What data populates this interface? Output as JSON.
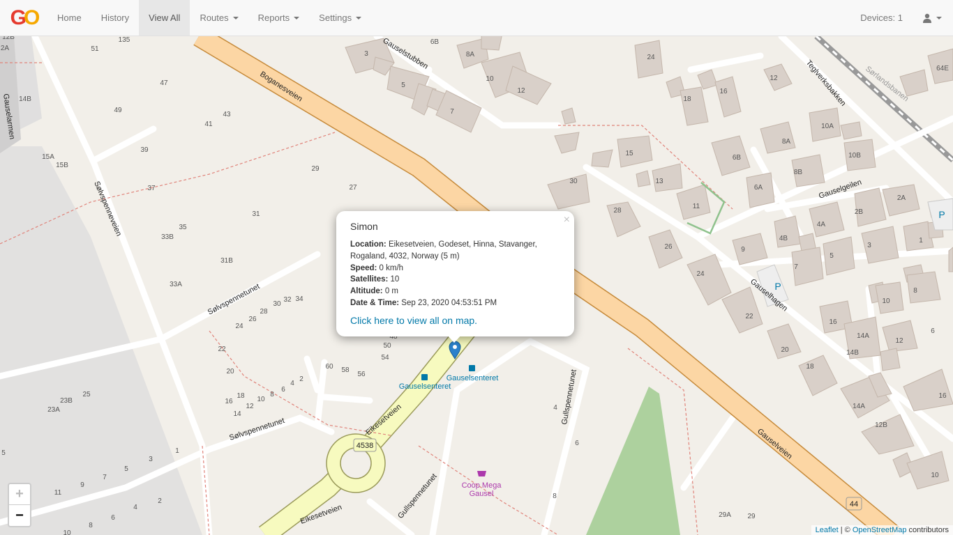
{
  "navbar": {
    "brand": {
      "g": "G",
      "o": "O"
    },
    "items": [
      {
        "label": "Home"
      },
      {
        "label": "History"
      },
      {
        "label": "View All"
      },
      {
        "label": "Routes"
      },
      {
        "label": "Reports"
      },
      {
        "label": "Settings"
      }
    ],
    "devices": "Devices: 1"
  },
  "map": {
    "streets": [
      "Boganesveien",
      "Gauselstubben",
      "Teglverksbakken",
      "Sørlandsbanen",
      "Gauselgeilen",
      "Gauselhagen",
      "Sølvspenneveien",
      "Sølvspennetunet",
      "Eikesetveien",
      "Gullspennetunet",
      "Gauselveien",
      "Gauselarmen"
    ],
    "road_numbers": [
      "4538",
      "44"
    ],
    "pois": [
      "Gauselsenteret",
      "Coop Mega Gausel"
    ],
    "house_numbers": [
      "135",
      "51",
      "47",
      "49",
      "43",
      "41",
      "39",
      "37",
      "29",
      "27",
      "31",
      "35",
      "33B",
      "31B",
      "33A",
      "32",
      "34",
      "30",
      "28",
      "26",
      "24",
      "22",
      "20",
      "18",
      "16",
      "14",
      "12",
      "10",
      "8",
      "6",
      "4",
      "2",
      "60",
      "58",
      "56",
      "54",
      "50",
      "48",
      "25",
      "23B",
      "23A",
      "1",
      "3",
      "5",
      "7",
      "9",
      "11",
      "15A",
      "15B",
      "14B",
      "12B",
      "2A",
      "3",
      "8A",
      "10",
      "12",
      "6B",
      "7",
      "24",
      "16",
      "18",
      "12",
      "64E",
      "15",
      "13",
      "11",
      "28",
      "26",
      "30",
      "24",
      "22",
      "9",
      "10A",
      "8A",
      "6B",
      "8B",
      "6A",
      "10B",
      "2A",
      "2B",
      "4A",
      "4B",
      "1",
      "3",
      "5",
      "7",
      "8",
      "10",
      "16",
      "20",
      "18",
      "12",
      "14A",
      "14B",
      "12B",
      "16",
      "6",
      "29A",
      "29"
    ],
    "parking": "P",
    "zoom_in": "+",
    "zoom_out": "−"
  },
  "popup": {
    "close": "×",
    "title": "Simon",
    "location_label": "Location:",
    "location": "Eikesetveien, Godeset, Hinna, Stavanger, Rogaland, 4032, Norway (5 m)",
    "speed_label": "Speed:",
    "speed": "0 km/h",
    "satellites_label": "Satellites:",
    "satellites": "10",
    "altitude_label": "Altitude:",
    "altitude": "0 m",
    "datetime_label": "Date & Time:",
    "datetime": "Sep 23, 2020 04:53:51 PM",
    "link": "Click here to view all on map."
  },
  "attribution": {
    "leaflet": "Leaflet",
    "sep": " | © ",
    "osm": "OpenStreetMap",
    "contributors": " contributors"
  },
  "colors": {
    "map_bg": "#f2efe9",
    "trunk_road": "#fcd6a4",
    "secondary_road": "#f7fabf",
    "building": "#d9d0c9",
    "park": "#add19e",
    "link": "#0078a8",
    "marker": "#2a81cb"
  }
}
